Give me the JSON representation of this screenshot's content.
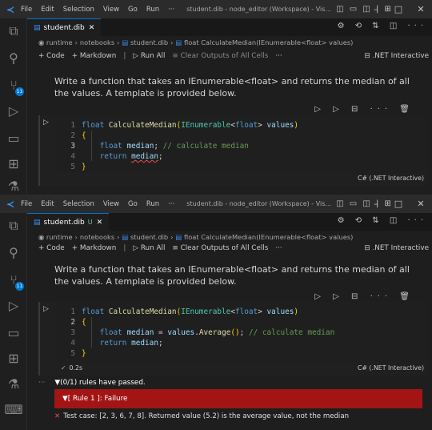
{
  "window_title": "student.dib - node_editor (Workspace) - Vis...",
  "window_title_2": "student.dib - node_editor (Workspace) - Vis...",
  "menu": [
    "File",
    "Edit",
    "Selection",
    "View",
    "Go",
    "Run",
    "···"
  ],
  "title_layout_icons": "◫ ▭ ◫ | ⊞",
  "window_controls": {
    "minimize": "–",
    "maximize": "□",
    "close": "✕"
  },
  "activity_icons": [
    "files-icon",
    "search-icon",
    "source-control-icon",
    "run-debug-icon",
    "remote-explorer-icon",
    "extensions-icon",
    "testing-icon",
    "terminal-icon",
    "polyglot-icon"
  ],
  "source_control_badge": "11",
  "tab": {
    "name": "student.dib",
    "modified": "U",
    "close": "✕"
  },
  "tab_actions": "⚙ ⟲ ⇅ ◫ ···",
  "breadcrumbs": [
    "runtime",
    "notebooks",
    "student.dib",
    "float CalculateMedian(IEnumerable<float> values)"
  ],
  "toolbar": {
    "code": "Code",
    "markdown": "Markdown",
    "run_all": "Run All",
    "clear_outputs": "Clear Outputs of All Cells",
    "more": "···",
    "kernel": ".NET Interactive"
  },
  "markdown_text": "Write a function that takes an IEnumerable<float> and returns the median of all the values. A template is provided below.",
  "cell_toolbar": "▷ ▷ ⊟ ··· 🗑",
  "cell_language": "C# (.NET Interactive)",
  "code_before": {
    "line_numbers": [
      "1",
      "2",
      "3",
      "4",
      "5"
    ],
    "l1_kw": "float",
    "l1_fn": "CalculateMedian",
    "l1_p_open": "(",
    "l1_type": "IEnumerable",
    "l1_lt": "<",
    "l1_type_arg": "float",
    "l1_gt": ">",
    "l1_param": "values",
    "l1_p_close": ")",
    "l2_brace": "{",
    "l3_kw": "float",
    "l3_var": "median",
    "l3_semi": ";",
    "l3_comment": "// calculate median",
    "l4_kw": "return",
    "l4_var": "median",
    "l4_semi": ";",
    "l5_brace": "}"
  },
  "code_after": {
    "line_numbers": [
      "1",
      "2",
      "3",
      "4",
      "5"
    ],
    "l1_kw": "float",
    "l1_fn": "CalculateMedian",
    "l1_p_open": "(",
    "l1_type": "IEnumerable",
    "l1_lt": "<",
    "l1_type_arg": "float",
    "l1_gt": ">",
    "l1_param": "values",
    "l1_p_close": ")",
    "l2_brace": "{",
    "l3_kw": "float",
    "l3_var": "median",
    "l3_eq": "=",
    "l3_obj": "values",
    "l3_dot": ".",
    "l3_fn": "Average",
    "l3_paren": "()",
    "l3_semi": ";",
    "l3_comment": "// calculate median",
    "l4_kw": "return",
    "l4_var": "median",
    "l4_semi": ";",
    "l5_brace": "}"
  },
  "execution": {
    "check": "✓",
    "time": "0.2s"
  },
  "output": {
    "dots": "···",
    "summary": "▼(0/1) rules have passed.",
    "rule_failure": "▼[ Rule 1 ]: Failure",
    "fail_icon": "✕",
    "test_case": "Test case: [2, 3, 6, 7, 8]. Returned value (5.2) is the average value, not the median"
  },
  "colors": {
    "accent": "#0078d4",
    "failure_bg": "#a31515",
    "success": "#89d185",
    "error": "#f14c4c"
  }
}
